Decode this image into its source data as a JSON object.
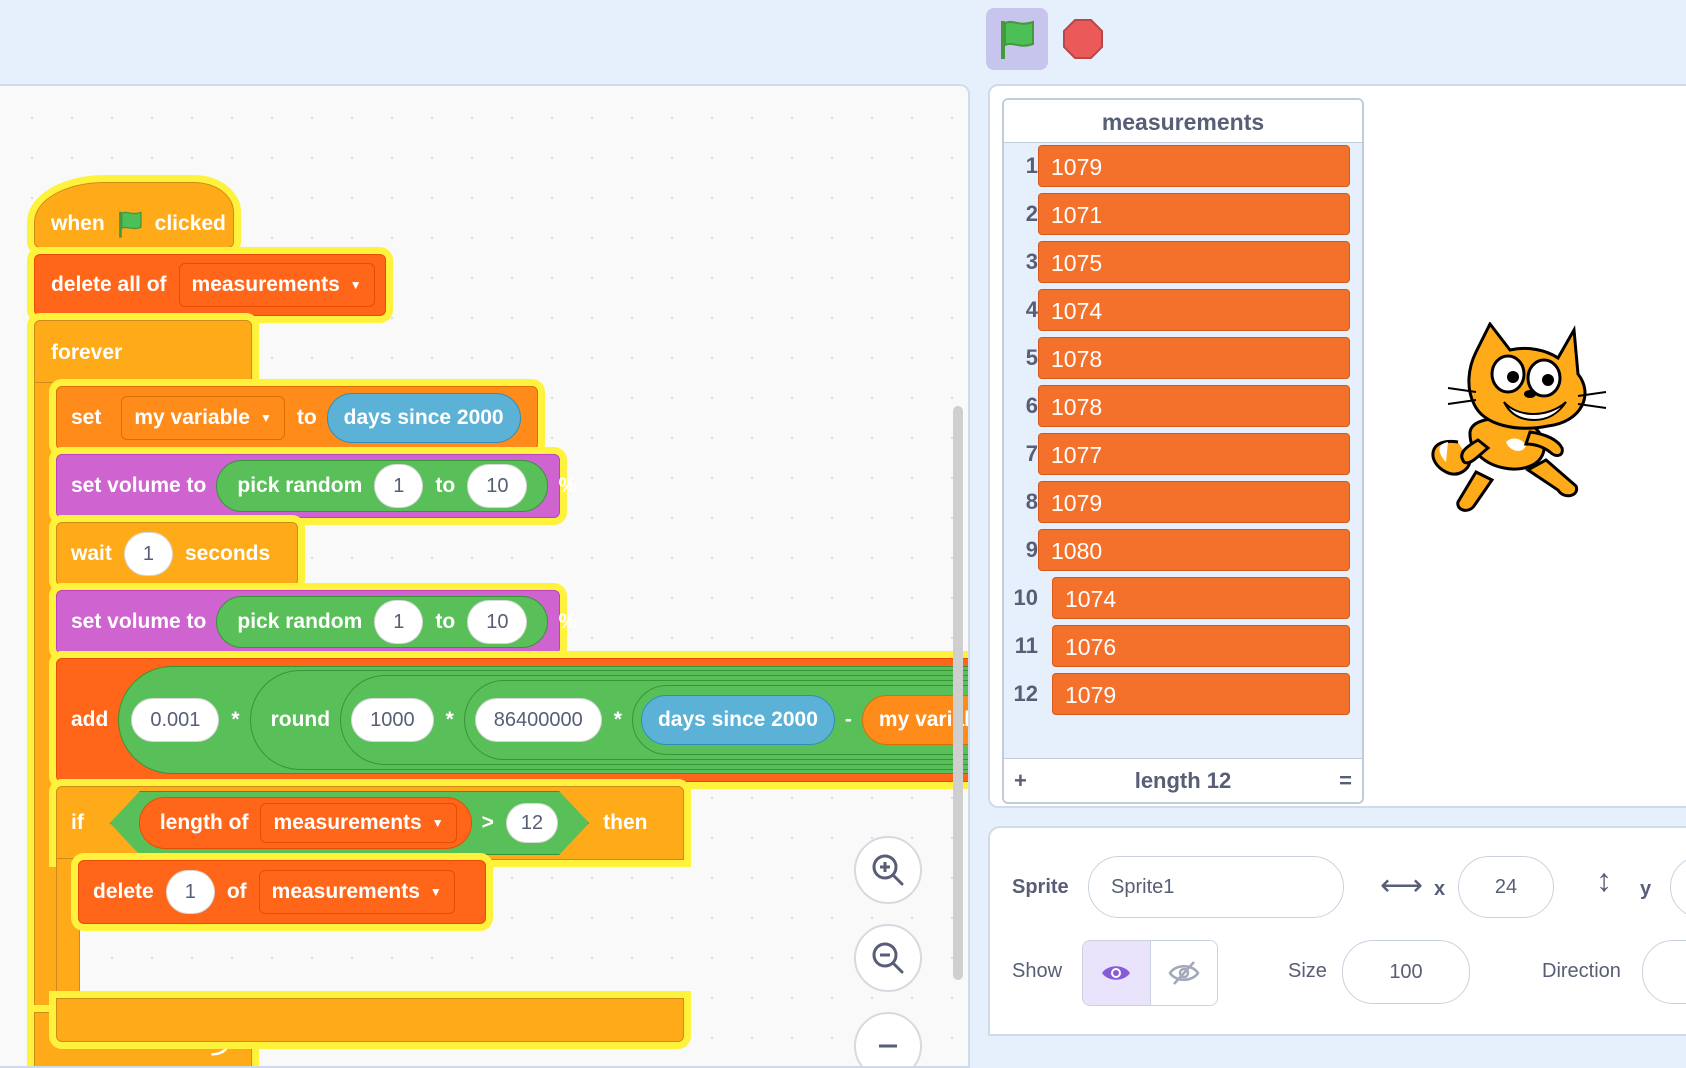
{
  "colors": {
    "control": "#ffab19",
    "list": "#ff661a",
    "variable": "#ff8c1a",
    "sound": "#cf63cf",
    "operator": "#59c059",
    "sensing": "#5cb1d6",
    "glow": "#fff23d",
    "list_item": "#f4712b"
  },
  "icons": {
    "green_flag": "green-flag-icon",
    "stop": "stop-sign-icon",
    "zoom_in": "zoom-in-icon",
    "zoom_out": "zoom-out-icon",
    "zoom_reset": "zoom-reset-icon",
    "show": "eye-icon",
    "hide": "eye-slash-icon",
    "x_arrow": "horizontal-arrow-icon",
    "y_arrow": "vertical-arrow-icon",
    "loop_arrow": "loop-arrow-icon",
    "sprite": "scratch-cat-sprite"
  },
  "script": {
    "hat": {
      "when": "when",
      "clicked": "clicked"
    },
    "delete_all": {
      "label": "delete all of",
      "list": "measurements"
    },
    "forever": "forever",
    "set_var": {
      "set": "set",
      "var": "my variable",
      "to": "to",
      "reporter": "days since 2000"
    },
    "volume1": {
      "label": "set volume to",
      "pick": "pick random",
      "from": "1",
      "to": "to",
      "max": "10",
      "pct": "%"
    },
    "wait": {
      "label": "wait",
      "value": "1",
      "unit": "seconds"
    },
    "volume2": {
      "label": "set volume to",
      "pick": "pick random",
      "from": "1",
      "to": "to",
      "max": "10",
      "pct": "%"
    },
    "add": {
      "label": "add",
      "v1": "0.001",
      "mul": "*",
      "round": "round",
      "v2": "1000",
      "v3": "86400000",
      "days": "days since 2000",
      "minus": "-",
      "myvar": "my variable"
    },
    "if": {
      "if": "if",
      "length_of": "length of",
      "list": "measurements",
      "gt": ">",
      "value": "12",
      "then": "then"
    },
    "delete": {
      "label": "delete",
      "value": "1",
      "of": "of",
      "list": "measurements"
    }
  },
  "list_monitor": {
    "title": "measurements",
    "items": [
      {
        "index": "1",
        "value": "1079"
      },
      {
        "index": "2",
        "value": "1071"
      },
      {
        "index": "3",
        "value": "1075"
      },
      {
        "index": "4",
        "value": "1074"
      },
      {
        "index": "5",
        "value": "1078"
      },
      {
        "index": "6",
        "value": "1078"
      },
      {
        "index": "7",
        "value": "1077"
      },
      {
        "index": "8",
        "value": "1079"
      },
      {
        "index": "9",
        "value": "1080"
      },
      {
        "index": "10",
        "value": "1074"
      },
      {
        "index": "11",
        "value": "1076"
      },
      {
        "index": "12",
        "value": "1079"
      }
    ],
    "add_label": "+",
    "length_label": "length 12",
    "resize_label": "="
  },
  "sprite_info": {
    "sprite_label": "Sprite",
    "sprite_name": "Sprite1",
    "x_label": "x",
    "x_value": "24",
    "y_label": "y",
    "show_label": "Show",
    "size_label": "Size",
    "size_value": "100",
    "direction_label": "Direction"
  }
}
